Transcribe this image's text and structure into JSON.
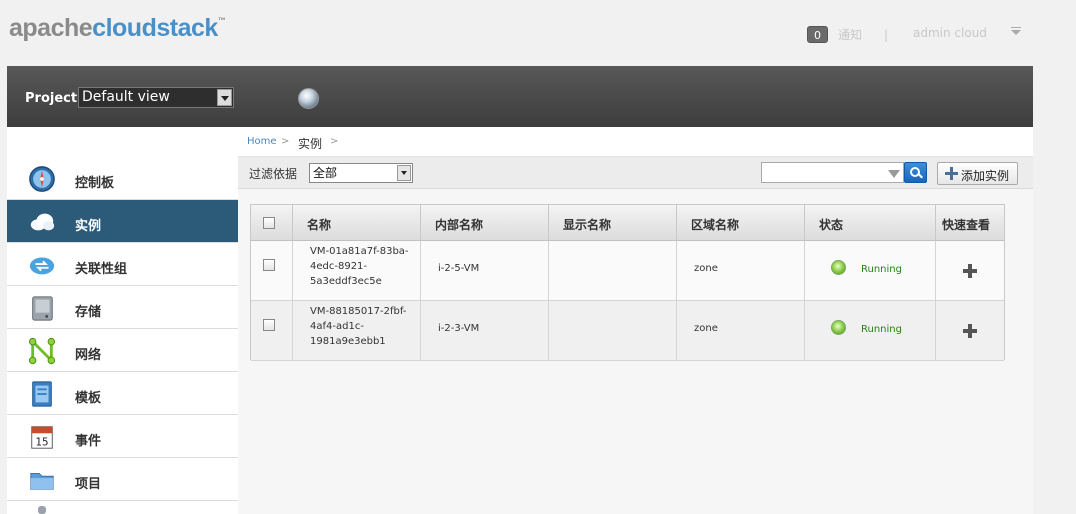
{
  "header": {
    "logo_part1": "apache",
    "logo_part2": "cloudstack",
    "logo_tm": "™",
    "notification_count": "0",
    "notification_label": "通知",
    "separator": "|",
    "username": "admin cloud"
  },
  "projectbar": {
    "label": "Project:",
    "selected": "Default view"
  },
  "sidebar": {
    "items": [
      {
        "label": "控制板",
        "icon": "dashboard-icon",
        "active": false
      },
      {
        "label": "实例",
        "icon": "cloud-icon",
        "active": true
      },
      {
        "label": "关联性组",
        "icon": "affinity-groups-icon",
        "active": false
      },
      {
        "label": "存储",
        "icon": "storage-icon",
        "active": false
      },
      {
        "label": "网络",
        "icon": "network-icon",
        "active": false
      },
      {
        "label": "模板",
        "icon": "template-icon",
        "active": false
      },
      {
        "label": "事件",
        "icon": "calendar-icon",
        "active": false
      },
      {
        "label": "项目",
        "icon": "folder-icon",
        "active": false
      }
    ]
  },
  "breadcrumb": {
    "home": "Home",
    "gt": ">",
    "current": "实例"
  },
  "toolbar": {
    "filter_label": "过滤依据",
    "filter_selected": "全部",
    "search_placeholder": "",
    "add_label": "添加实例"
  },
  "table": {
    "columns": [
      "名称",
      "内部名称",
      "显示名称",
      "区域名称",
      "状态",
      "快速查看"
    ],
    "rows": [
      {
        "name_lines": [
          "VM-01a81a7f-83ba-",
          "4edc-8921-",
          "5a3eddf3ec5e"
        ],
        "internal_name": "i-2-5-VM",
        "display_name": "",
        "zone": "zone",
        "state": "Running"
      },
      {
        "name_lines": [
          "VM-88185017-2fbf-",
          "4af4-ad1c-",
          "1981a9e3ebb1"
        ],
        "internal_name": "i-2-3-VM",
        "display_name": "",
        "zone": "zone",
        "state": "Running"
      }
    ]
  },
  "colors": {
    "active_nav": "#2c5a79",
    "darkbar": "#484848",
    "running": "#2a7f1a",
    "link": "#4a87c0"
  }
}
